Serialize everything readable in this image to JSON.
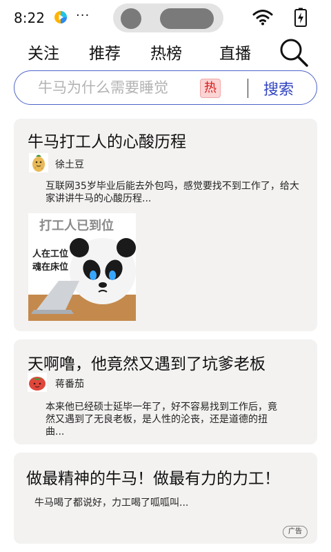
{
  "status_bar": {
    "time": "8:22",
    "more_indicator": "···",
    "icons": [
      "video-app-icon",
      "wifi-icon",
      "battery-charging-icon"
    ]
  },
  "tabs": [
    {
      "label": "关注"
    },
    {
      "label": "推荐"
    },
    {
      "label": "热榜"
    },
    {
      "label": "直播"
    }
  ],
  "search": {
    "placeholder": "牛马为什么需要睡觉",
    "hot_badge": "热",
    "button_label": "搜索",
    "icon": "search-icon"
  },
  "feed": [
    {
      "title": "牛马打工人的心酸历程",
      "author": "徐土豆",
      "avatar_icon": "potato-avatar-icon",
      "excerpt": "互联网35岁毕业后能去外包吗，感觉要找不到工作了，给大家讲讲牛马的心酸历程...",
      "image": {
        "heading": "打工人已到位",
        "caption_line1": "人在工位",
        "caption_line2": "魂在床位"
      }
    },
    {
      "title": "天啊噜，他竟然又遇到了坑爹老板",
      "author": "蒋番茄",
      "avatar_icon": "tomato-avatar-icon",
      "excerpt": "本来他已经硕士延毕一年了，好不容易找到工作后，竟然又遇到了无良老板，是人性的沦丧，还是道德的扭曲..."
    },
    {
      "title": "做最精神的牛马！做最有力的力工！",
      "excerpt": "牛马喝了都说好，力工喝了呱呱叫...",
      "ad_label": "广告"
    }
  ],
  "colors": {
    "accent": "#2f43c0",
    "search_border": "#4d63c8",
    "hot_badge_bg": "#fbd4d4",
    "hot_badge_text": "#d81b1b",
    "card_bg": "#f3f2f1"
  }
}
